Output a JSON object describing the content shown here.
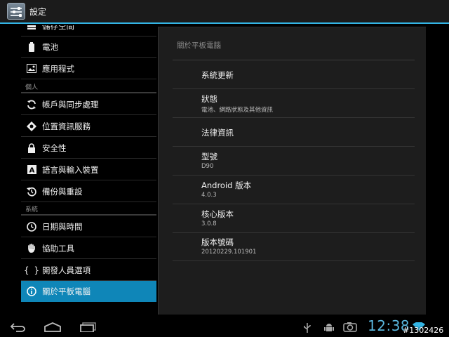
{
  "action_bar": {
    "title": "設定"
  },
  "sidebar": {
    "items_top": [
      {
        "label": "儲存空間",
        "icon": "storage-icon"
      },
      {
        "label": "電池",
        "icon": "battery-icon"
      },
      {
        "label": "應用程式",
        "icon": "apps-icon"
      }
    ],
    "header_personal": "個人",
    "items_personal": [
      {
        "label": "帳戶與同步處理",
        "icon": "sync-icon"
      },
      {
        "label": "位置資訊服務",
        "icon": "location-icon"
      },
      {
        "label": "安全性",
        "icon": "lock-icon"
      },
      {
        "label": "語言與輸入裝置",
        "icon": "language-icon"
      },
      {
        "label": "備份與重設",
        "icon": "backup-icon"
      }
    ],
    "header_system": "系統",
    "items_system": [
      {
        "label": "日期與時間",
        "icon": "clock-icon"
      },
      {
        "label": "協助工具",
        "icon": "hand-icon"
      },
      {
        "label": "開發人員選項",
        "icon": "braces-icon"
      },
      {
        "label": "關於平板電腦",
        "icon": "info-icon",
        "selected": true
      }
    ]
  },
  "detail": {
    "title": "關於平板電腦",
    "rows": [
      {
        "title": "系統更新",
        "summary": ""
      },
      {
        "title": "狀態",
        "summary": "電池、網路狀態及其他資訊"
      },
      {
        "title": "法律資訊",
        "summary": ""
      },
      {
        "title": "型號",
        "summary": "D90"
      },
      {
        "title": "Android 版本",
        "summary": "4.0.3"
      },
      {
        "title": "核心版本",
        "summary": "3.0.8"
      },
      {
        "title": "版本號碼",
        "summary": "20120229.101901"
      }
    ]
  },
  "status_bar": {
    "time": "12:38",
    "watermark": "#1302426"
  },
  "colors": {
    "accent": "#33b5e5",
    "selected": "#0f86b8",
    "clock": "#5ab7de"
  }
}
